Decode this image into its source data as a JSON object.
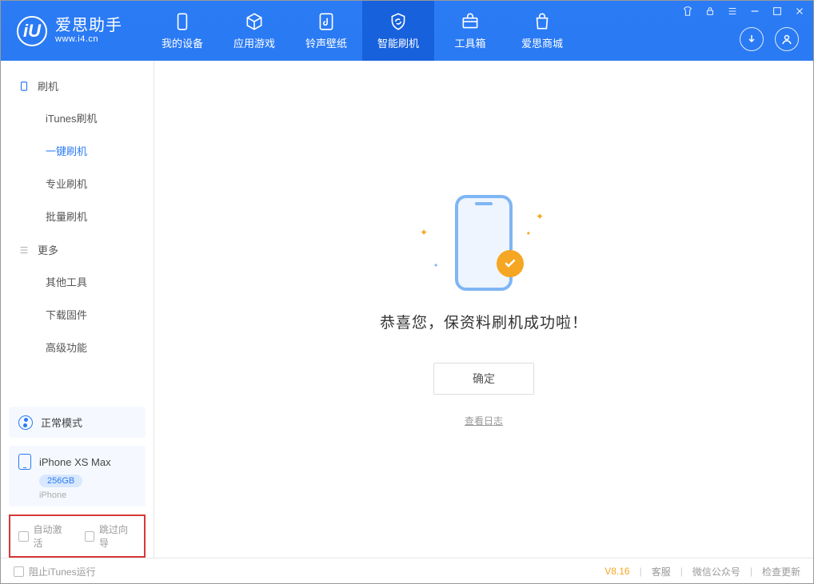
{
  "app": {
    "name": "爱思助手",
    "url": "www.i4.cn",
    "logo_char": "iU"
  },
  "tabs": [
    {
      "label": "我的设备"
    },
    {
      "label": "应用游戏"
    },
    {
      "label": "铃声壁纸"
    },
    {
      "label": "智能刷机"
    },
    {
      "label": "工具箱"
    },
    {
      "label": "爱思商城"
    }
  ],
  "sidebar": {
    "group1": {
      "title": "刷机",
      "items": [
        "iTunes刷机",
        "一键刷机",
        "专业刷机",
        "批量刷机"
      ],
      "active_index": 1
    },
    "group2": {
      "title": "更多",
      "items": [
        "其他工具",
        "下载固件",
        "高级功能"
      ]
    }
  },
  "status": {
    "label": "正常模式"
  },
  "device": {
    "name": "iPhone XS Max",
    "storage": "256GB",
    "type": "iPhone"
  },
  "options": {
    "auto_activate": "自动激活",
    "skip_guide": "跳过向导"
  },
  "main": {
    "message": "恭喜您，保资料刷机成功啦！",
    "ok": "确定",
    "view_log": "查看日志"
  },
  "footer": {
    "block_itunes": "阻止iTunes运行",
    "version": "V8.16",
    "link1": "客服",
    "link2": "微信公众号",
    "link3": "检查更新"
  }
}
